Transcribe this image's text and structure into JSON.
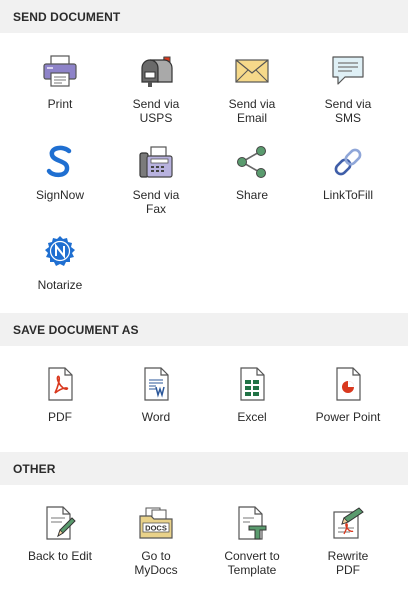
{
  "sections": {
    "send": {
      "title": "SEND DOCUMENT",
      "items": [
        {
          "label": "Print",
          "icon": "printer-icon"
        },
        {
          "label": "Send via\nUSPS",
          "icon": "mailbox-icon"
        },
        {
          "label": "Send via\nEmail",
          "icon": "envelope-icon"
        },
        {
          "label": "Send via\nSMS",
          "icon": "chat-bubble-icon"
        },
        {
          "label": "SignNow",
          "icon": "signnow-icon"
        },
        {
          "label": "Send via\nFax",
          "icon": "fax-icon"
        },
        {
          "label": "Share",
          "icon": "share-icon"
        },
        {
          "label": "LinkToFill",
          "icon": "link-icon"
        },
        {
          "label": "Notarize",
          "icon": "notarize-icon"
        }
      ]
    },
    "save": {
      "title": "SAVE DOCUMENT AS",
      "items": [
        {
          "label": "PDF",
          "icon": "pdf-file-icon"
        },
        {
          "label": "Word",
          "icon": "word-file-icon"
        },
        {
          "label": "Excel",
          "icon": "excel-file-icon"
        },
        {
          "label": "Power Point",
          "icon": "powerpoint-file-icon"
        }
      ]
    },
    "other": {
      "title": "OTHER",
      "items": [
        {
          "label": "Back to Edit",
          "icon": "edit-document-icon"
        },
        {
          "label": "Go to\nMyDocs",
          "icon": "docs-folder-icon",
          "icon_text": "DOCS"
        },
        {
          "label": "Convert to\nTemplate",
          "icon": "template-icon"
        },
        {
          "label": "Rewrite\nPDF",
          "icon": "rewrite-pdf-icon"
        }
      ]
    }
  },
  "colors": {
    "header_bg": "#f1f1f1",
    "pdf_red": "#d9381e",
    "word_blue": "#2b579a",
    "excel_green": "#217346",
    "signnow_blue": "#1f6fd1",
    "share_green": "#5a9b6e"
  }
}
